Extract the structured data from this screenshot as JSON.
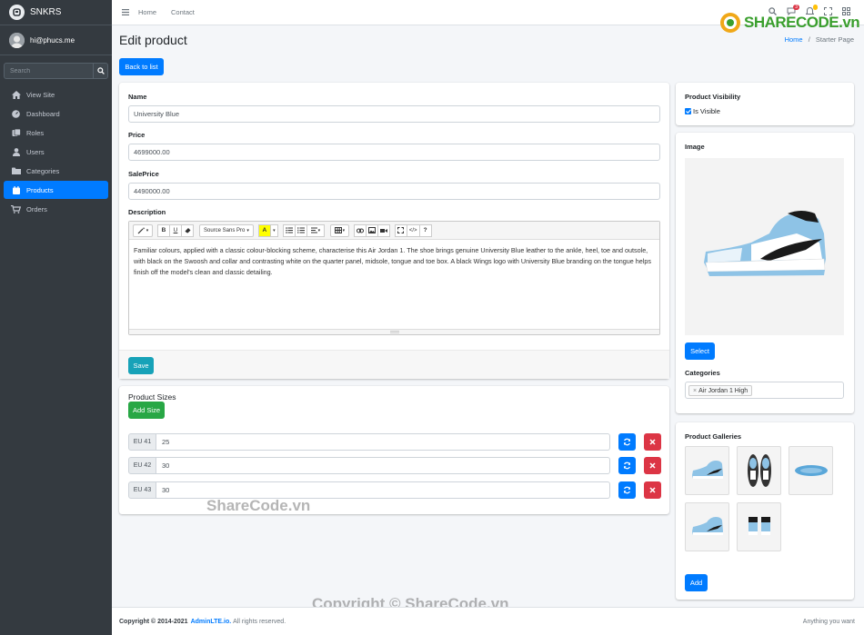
{
  "brand": {
    "name": "SNKRS"
  },
  "user": {
    "name": "hi@phucs.me"
  },
  "sidebar": {
    "search_placeholder": "Search",
    "items": [
      {
        "label": "View Site",
        "icon": "home-icon"
      },
      {
        "label": "Dashboard",
        "icon": "dashboard-icon"
      },
      {
        "label": "Roles",
        "icon": "roles-icon"
      },
      {
        "label": "Users",
        "icon": "user-icon"
      },
      {
        "label": "Categories",
        "icon": "folder-icon"
      },
      {
        "label": "Products",
        "icon": "calendar-icon",
        "active": true
      },
      {
        "label": "Orders",
        "icon": "cart-icon"
      }
    ]
  },
  "topbar": {
    "links": [
      "Home",
      "Contact"
    ],
    "notif_count": "3",
    "msg_count": ""
  },
  "watermark": {
    "logo": "SHARECODE.vn",
    "mid": "ShareCode.vn",
    "bottom": "Copyright © ShareCode.vn"
  },
  "page": {
    "title": "Edit product",
    "breadcrumb_home": "Home",
    "breadcrumb_sep": "/",
    "breadcrumb_current": "Starter Page",
    "back_button": "Back to list"
  },
  "form": {
    "name_label": "Name",
    "name_value": "University Blue",
    "price_label": "Price",
    "price_value": "4699000.00",
    "saleprice_label": "SalePrice",
    "saleprice_value": "4490000.00",
    "description_label": "Description",
    "font_name": "Source Sans Pro",
    "description_text": "Familiar colours, applied with a classic colour-blocking scheme, characterise this Air Jordan 1. The shoe brings genuine University Blue leather to the ankle, heel, toe and outsole, with black on the Swoosh and collar and contrasting white on the quarter panel, midsole, tongue and toe box. A black Wings logo with University Blue branding on the tongue helps finish off the model's clean and classic detailing.",
    "save_button": "Save"
  },
  "sizes": {
    "title": "Product Sizes",
    "add_button": "Add Size",
    "rows": [
      {
        "size": "EU 41",
        "qty": "25"
      },
      {
        "size": "EU 42",
        "qty": "30"
      },
      {
        "size": "EU 43",
        "qty": "30"
      }
    ]
  },
  "visibility": {
    "title": "Product Visibility",
    "checkbox_label": "Is Visible",
    "checked": true
  },
  "image": {
    "title": "Image",
    "select_button": "Select",
    "categories_label": "Categories",
    "category_tag_remove": "×",
    "category_tag": "Air Jordan 1 High"
  },
  "gallery": {
    "title": "Product Galleries",
    "add_button": "Add"
  },
  "footer": {
    "copyright": "Copyright © 2014-2021 ",
    "brand": "AdminLTE.io.",
    "rights": " All rights reserved.",
    "right_text": "Anything you want"
  },
  "colors": {
    "primary": "#007bff",
    "sidebar": "#343a40",
    "success": "#28a745",
    "danger": "#dc3545",
    "info": "#17a2b8",
    "shoe_blue": "#8ec3e6"
  }
}
